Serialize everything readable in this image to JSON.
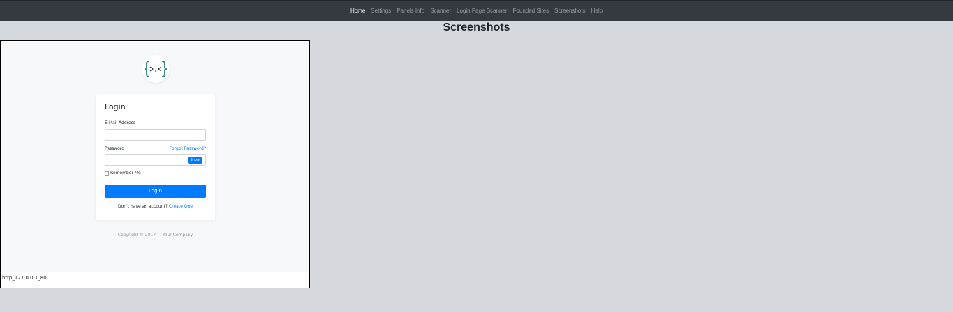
{
  "nav": {
    "items": [
      {
        "label": "Home",
        "active": true
      },
      {
        "label": "Settings",
        "active": false
      },
      {
        "label": "Panels Info",
        "active": false
      },
      {
        "label": "Scanner",
        "active": false
      },
      {
        "label": "Login Page Scanner",
        "active": false
      },
      {
        "label": "Founded Sites",
        "active": false
      },
      {
        "label": "Screenshots",
        "active": false
      },
      {
        "label": "Help",
        "active": false
      }
    ]
  },
  "page": {
    "title": "Screenshots"
  },
  "screenshot": {
    "caption": "http_127.0.0.1_80",
    "login_page": {
      "title": "Login",
      "email_label": "E-Mail Address",
      "email_value": "",
      "password_label": "Password",
      "password_value": "",
      "forgot_password": "Forgot Password?",
      "show_label": "Show",
      "remember_label": "Remember Me",
      "login_button": "Login",
      "signup_prompt": "Don't have an account?",
      "create_link": "Create One",
      "copyright": "Copyright © 2017 — Your Company"
    }
  },
  "colors": {
    "navbar_bg": "#343a40",
    "page_bg": "#d5d8dc",
    "accent": "#007bff",
    "logo_teal": "#3b8c8c"
  },
  "icons": {
    "logo": "code-brackets-logo-icon"
  }
}
